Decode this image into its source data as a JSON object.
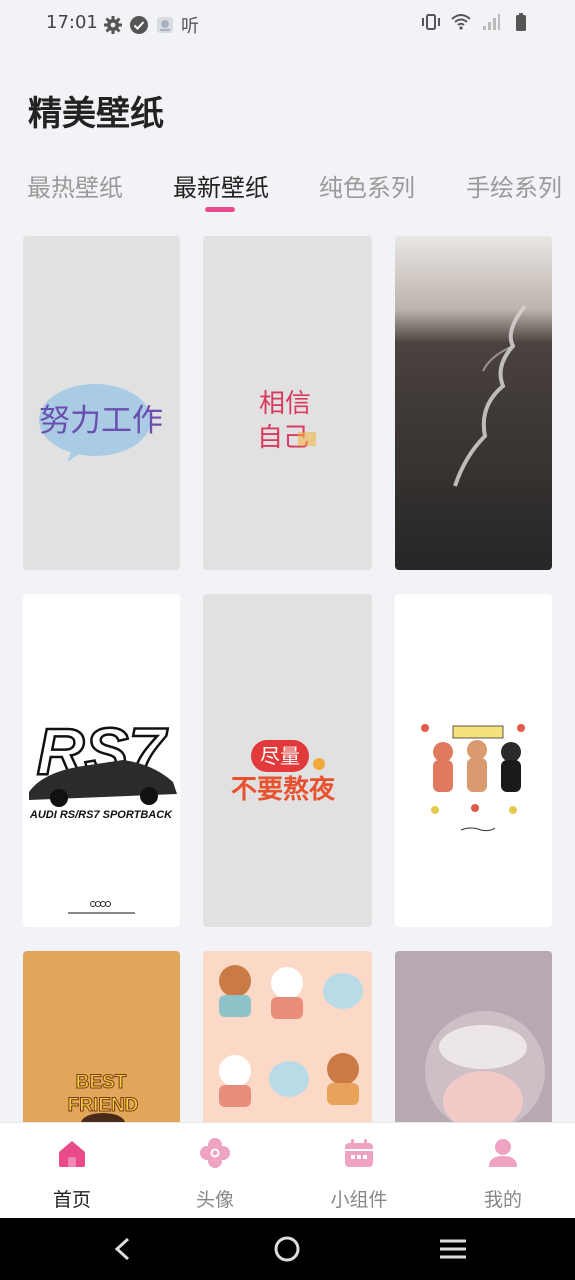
{
  "status_bar": {
    "time": "17:01",
    "left_text": "听",
    "icons": [
      "settings-icon",
      "check-circle-icon",
      "notification-app-icon",
      "vibrate-icon",
      "wifi-icon",
      "signal-icon",
      "battery-icon"
    ]
  },
  "header": {
    "title": "精美壁纸"
  },
  "tabs": [
    {
      "label": "最热壁纸",
      "active": false
    },
    {
      "label": "最新壁纸",
      "active": true
    },
    {
      "label": "纯色系列",
      "active": false
    },
    {
      "label": "手绘系列",
      "active": false
    }
  ],
  "wallpapers": [
    {
      "text": "努力工作"
    },
    {
      "text_line1": "相信",
      "text_line2": "自己"
    },
    {
      "text": ""
    },
    {
      "text_big": "RS7",
      "text_sub": "AUDI RS/RS7 SPORTBACK"
    },
    {
      "text_top": "尽量",
      "text_bottom": "不要熬夜"
    },
    {
      "text": ""
    },
    {
      "text_line1": "BEST",
      "text_line2": "FRIEND"
    },
    {
      "text": ""
    },
    {
      "text": ""
    }
  ],
  "bottom_nav": [
    {
      "label": "首页",
      "icon": "home-icon",
      "active": true
    },
    {
      "label": "头像",
      "icon": "avatar-flower-icon",
      "active": false
    },
    {
      "label": "小组件",
      "icon": "calendar-widget-icon",
      "active": false
    },
    {
      "label": "我的",
      "icon": "profile-icon",
      "active": false
    }
  ],
  "colors": {
    "accent": "#e84a8a",
    "icon_inactive": "#f0a2c2",
    "background": "#f1f3f6"
  }
}
